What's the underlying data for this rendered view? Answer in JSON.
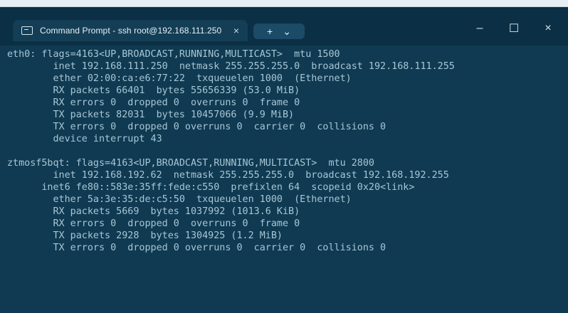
{
  "window": {
    "tab_title": "Command Prompt - ssh root@192.168.111.250",
    "tab_close_symbol": "×",
    "new_tab_symbol": "+",
    "new_tab_menu_symbol": "⌄",
    "controls": {
      "minimize_symbol": "–",
      "maximize_symbol": "☐",
      "close_symbol": "×"
    }
  },
  "terminal": {
    "lines": [
      "eth0: flags=4163<UP,BROADCAST,RUNNING,MULTICAST>  mtu 1500",
      "        inet 192.168.111.250  netmask 255.255.255.0  broadcast 192.168.111.255",
      "        ether 02:00:ca:e6:77:22  txqueuelen 1000  (Ethernet)",
      "        RX packets 66401  bytes 55656339 (53.0 MiB)",
      "        RX errors 0  dropped 0  overruns 0  frame 0",
      "        TX packets 82031  bytes 10457066 (9.9 MiB)",
      "        TX errors 0  dropped 0 overruns 0  carrier 0  collisions 0",
      "        device interrupt 43",
      "",
      "ztmosf5bqt: flags=4163<UP,BROADCAST,RUNNING,MULTICAST>  mtu 2800",
      "        inet 192.168.192.62  netmask 255.255.255.0  broadcast 192.168.192.255",
      "      inet6 fe80::583e:35ff:fede:c550  prefixlen 64  scopeid 0x20<link>",
      "        ether 5a:3e:35:de:c5:50  txqueuelen 1000  (Ethernet)",
      "        RX packets 5669  bytes 1037992 (1013.6 KiB)",
      "        RX errors 0  dropped 0  overruns 0  frame 0",
      "        TX packets 2928  bytes 1304925 (1.2 MiB)",
      "        TX errors 0  dropped 0 overruns 0  carrier 0  collisions 0"
    ]
  }
}
